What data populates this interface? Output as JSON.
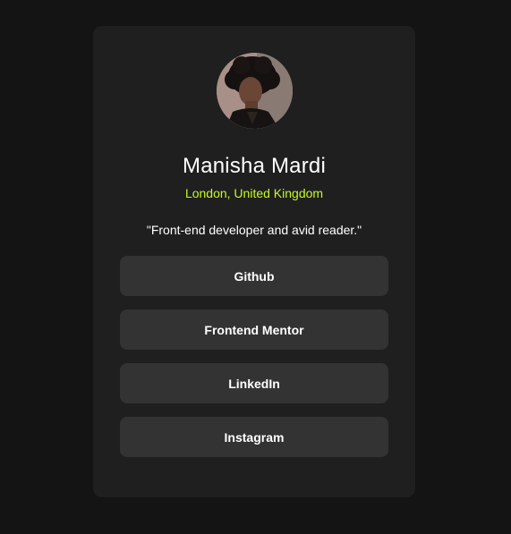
{
  "profile": {
    "name": "Manisha Mardi",
    "location": "London, United Kingdom",
    "bio": "\"Front-end developer and avid reader.\""
  },
  "links": [
    {
      "label": "Github"
    },
    {
      "label": "Frontend Mentor"
    },
    {
      "label": "LinkedIn"
    },
    {
      "label": "Instagram"
    }
  ],
  "colors": {
    "page_background": "#141414",
    "card_background": "#1f1f1f",
    "button_background": "#333333",
    "accent": "#c4f82a",
    "text": "#ffffff"
  }
}
